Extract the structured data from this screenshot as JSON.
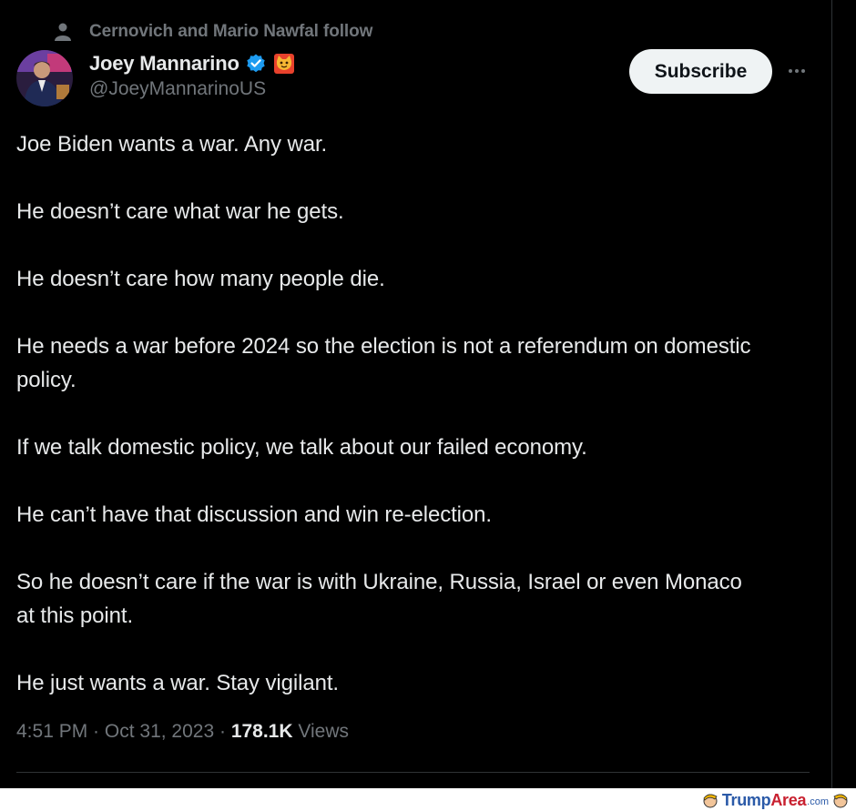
{
  "social_context": {
    "text": "Cernovich and Mario Nawfal follow",
    "icon": "person-icon"
  },
  "author": {
    "display_name": "Joey Mannarino",
    "handle": "@JoeyMannarinoUS",
    "verified_icon": "verified-badge-icon",
    "emoji_icon": "cat-emoji-icon"
  },
  "actions": {
    "subscribe_label": "Subscribe",
    "more_icon": "more-options-icon"
  },
  "tweet": {
    "paragraphs": [
      "Joe Biden wants a war. Any war.",
      "He doesn’t care what war he gets.",
      "He doesn’t care how many people die.",
      "He needs a war before 2024 so the election is not a referendum on domestic policy.",
      "If we talk domestic policy, we talk about our failed economy.",
      "He can’t have that discussion and win re-election.",
      "So he doesn’t care if the war is with Ukraine, Russia, Israel or even Monaco at this point.",
      "He just wants a war. Stay vigilant."
    ]
  },
  "meta": {
    "time": "4:51 PM",
    "sep1": " · ",
    "date": "Oct 31, 2023",
    "sep2": " · ",
    "views_count": "178.1K",
    "views_label": " Views"
  },
  "watermark": {
    "brand_part1": "Trump",
    "brand_part2": "Area",
    "domain_suffix": ".com"
  },
  "colors": {
    "background": "#000000",
    "text_primary": "#e7e9ea",
    "text_secondary": "#71767b",
    "verified_blue": "#1d9bf0",
    "subscribe_bg": "#eff3f4"
  }
}
